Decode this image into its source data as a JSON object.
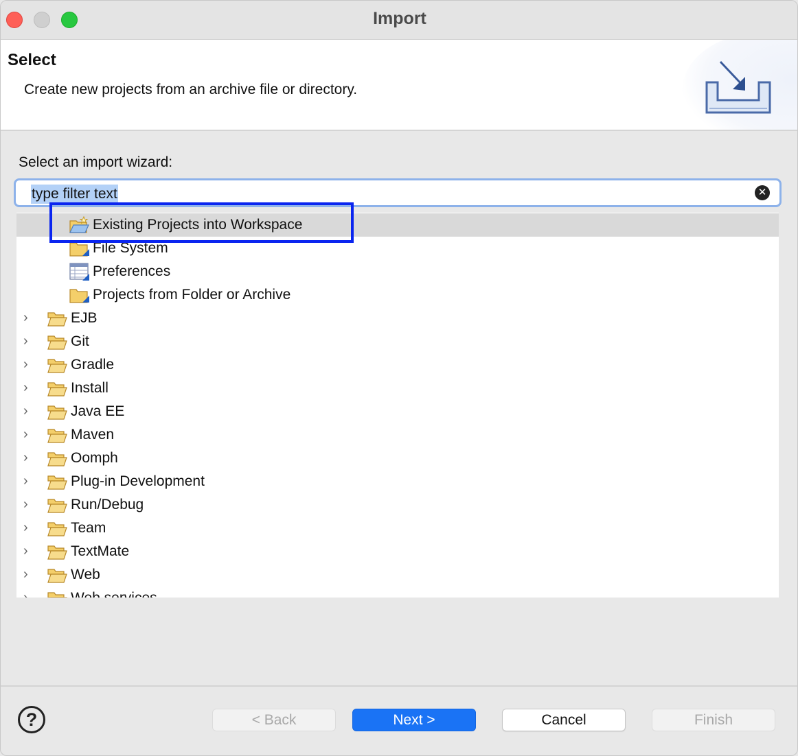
{
  "window": {
    "title": "Import"
  },
  "banner": {
    "title": "Select",
    "description": "Create new projects from an archive file or directory.",
    "icon": "import-wizard-icon"
  },
  "wizard": {
    "label": "Select an import wizard:",
    "filter_value": "type filter text"
  },
  "tree": {
    "items": [
      {
        "label": "Existing Projects into Workspace",
        "icon": "projects-folder-icon",
        "selected": true
      },
      {
        "label": "File System",
        "icon": "folder-icon"
      },
      {
        "label": "Preferences",
        "icon": "preferences-icon"
      },
      {
        "label": "Projects from Folder or Archive",
        "icon": "folder-icon"
      },
      {
        "label": "EJB",
        "icon": "folder-open-icon",
        "expandable": true
      },
      {
        "label": "Git",
        "icon": "folder-open-icon",
        "expandable": true
      },
      {
        "label": "Gradle",
        "icon": "folder-open-icon",
        "expandable": true
      },
      {
        "label": "Install",
        "icon": "folder-open-icon",
        "expandable": true
      },
      {
        "label": "Java EE",
        "icon": "folder-open-icon",
        "expandable": true
      },
      {
        "label": "Maven",
        "icon": "folder-open-icon",
        "expandable": true
      },
      {
        "label": "Oomph",
        "icon": "folder-open-icon",
        "expandable": true
      },
      {
        "label": "Plug-in Development",
        "icon": "folder-open-icon",
        "expandable": true
      },
      {
        "label": "Run/Debug",
        "icon": "folder-open-icon",
        "expandable": true
      },
      {
        "label": "Team",
        "icon": "folder-open-icon",
        "expandable": true
      },
      {
        "label": "TextMate",
        "icon": "folder-open-icon",
        "expandable": true
      },
      {
        "label": "Web",
        "icon": "folder-open-icon",
        "expandable": true
      },
      {
        "label": "Web services",
        "icon": "folder-open-icon",
        "expandable": true
      }
    ]
  },
  "footer": {
    "help_symbol": "?",
    "back_label": "< Back",
    "next_label": "Next >",
    "cancel_label": "Cancel",
    "finish_label": "Finish"
  },
  "colors": {
    "accent": "#1a73f5",
    "highlight_box": "#0a25f0",
    "selection_bg": "#d9d9d9",
    "filter_selection": "#b3d1f7"
  }
}
